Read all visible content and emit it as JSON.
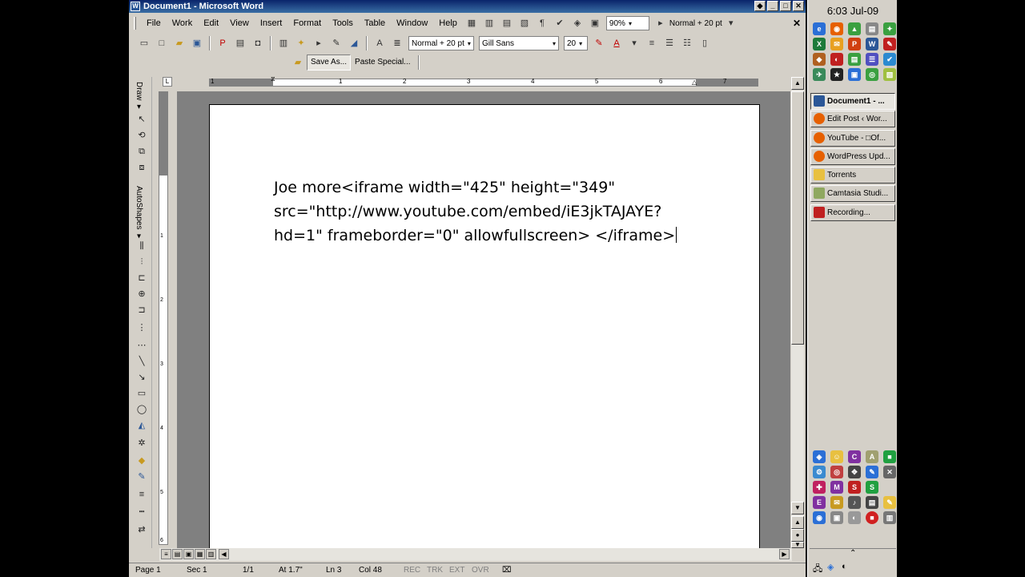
{
  "window": {
    "title": "Document1 - Microsoft Word"
  },
  "menu": [
    "File",
    "Work",
    "Edit",
    "View",
    "Insert",
    "Format",
    "Tools",
    "Table",
    "Window",
    "Help"
  ],
  "toolbar": {
    "zoom": "90%",
    "style_top": "Normal + 20 pt",
    "style": "Normal + 20 pt",
    "font": "Gill Sans",
    "size": "20",
    "save_as": "Save As...",
    "paste_special": "Paste Special..."
  },
  "ruler": [
    "1",
    "1",
    "2",
    "3",
    "4",
    "5",
    "6",
    "7"
  ],
  "vruler": [
    "1",
    "2",
    "3",
    "4",
    "5",
    "6"
  ],
  "document": {
    "line1": "Joe more<iframe width=\"425\" height=\"349\"",
    "line2": "src=\"http://www.youtube.com/embed/iE3jkTAJAYE?",
    "line3": "hd=1\" frameborder=\"0\" allowfullscreen> </iframe>"
  },
  "left_toolbar": {
    "draw": "Draw ▾",
    "autoshapes": "AutoShapes ▾"
  },
  "status": {
    "page": "Page 1",
    "sec": "Sec 1",
    "pages": "1/1",
    "at": "At 1.7\"",
    "ln": "Ln 3",
    "col": "Col 48",
    "rec": "REC",
    "trk": "TRK",
    "ext": "EXT",
    "ovr": "OVR"
  },
  "sidebar": {
    "clock": "6:03  Jul-09",
    "tasks": [
      {
        "label": "Document1 - ...",
        "color": "#2b5797"
      },
      {
        "label": "Edit Post ‹ Wor...",
        "color": "#e66000"
      },
      {
        "label": "YouTube - □Of...",
        "color": "#e66000"
      },
      {
        "label": "WordPress Upd...",
        "color": "#e66000"
      },
      {
        "label": "Torrents",
        "color": "#e8c040"
      },
      {
        "label": "Camtasia Studi...",
        "color": "#8fa860"
      },
      {
        "label": "Recording...",
        "color": "#c02020"
      }
    ]
  }
}
